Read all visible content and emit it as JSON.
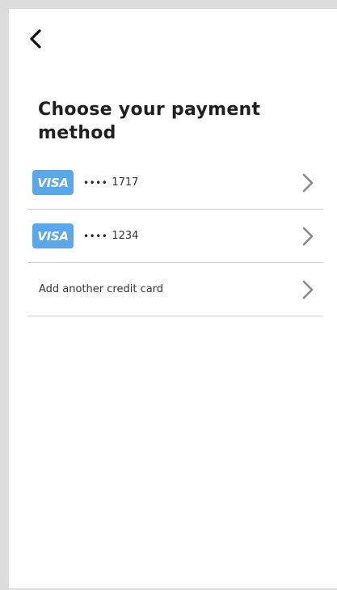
{
  "header": {
    "back_icon": "chevron-left-icon"
  },
  "page": {
    "title": "Choose your payment method"
  },
  "cards": [
    {
      "brand": "VISA",
      "masked": "••••",
      "last4": "1717"
    },
    {
      "brand": "VISA",
      "masked": "••••",
      "last4": "1234"
    }
  ],
  "add_card": {
    "label": "Add another credit card"
  },
  "colors": {
    "visa_badge": "#5aa8ec",
    "chevron": "#8a8a8a",
    "divider": "#c8c8c8",
    "title": "#1f1f1f"
  }
}
